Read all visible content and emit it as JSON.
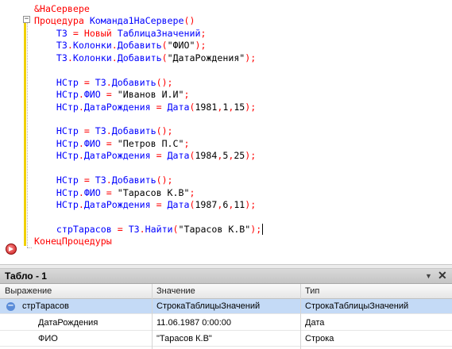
{
  "editor": {
    "lines": [
      [
        [
          "kw",
          "&НаСервере"
        ]
      ],
      [
        [
          "kw",
          "Процедура "
        ],
        [
          "id",
          "Команда1НаСервере"
        ],
        [
          "op",
          "()"
        ]
      ],
      [
        [
          "kw",
          "    "
        ],
        [
          "id",
          "ТЗ"
        ],
        [
          "op",
          " = "
        ],
        [
          "kw",
          "Новый "
        ],
        [
          "id",
          "ТаблицаЗначений"
        ],
        [
          "op",
          ";"
        ]
      ],
      [
        [
          "kw",
          "    "
        ],
        [
          "id",
          "ТЗ"
        ],
        [
          "op",
          "."
        ],
        [
          "id",
          "Колонки"
        ],
        [
          "op",
          "."
        ],
        [
          "id",
          "Добавить"
        ],
        [
          "op",
          "("
        ],
        [
          "str",
          "\"ФИО\""
        ],
        [
          "op",
          ");"
        ]
      ],
      [
        [
          "kw",
          "    "
        ],
        [
          "id",
          "ТЗ"
        ],
        [
          "op",
          "."
        ],
        [
          "id",
          "Колонки"
        ],
        [
          "op",
          "."
        ],
        [
          "id",
          "Добавить"
        ],
        [
          "op",
          "("
        ],
        [
          "str",
          "\"ДатаРождения\""
        ],
        [
          "op",
          ");"
        ]
      ],
      [
        [
          "kw",
          ""
        ]
      ],
      [
        [
          "kw",
          "    "
        ],
        [
          "id",
          "НСтр"
        ],
        [
          "op",
          " = "
        ],
        [
          "id",
          "ТЗ"
        ],
        [
          "op",
          "."
        ],
        [
          "id",
          "Добавить"
        ],
        [
          "op",
          "();"
        ]
      ],
      [
        [
          "kw",
          "    "
        ],
        [
          "id",
          "НСтр"
        ],
        [
          "op",
          "."
        ],
        [
          "id",
          "ФИО"
        ],
        [
          "op",
          " = "
        ],
        [
          "str",
          "\"Иванов И.И\""
        ],
        [
          "op",
          ";"
        ]
      ],
      [
        [
          "kw",
          "    "
        ],
        [
          "id",
          "НСтр"
        ],
        [
          "op",
          "."
        ],
        [
          "id",
          "ДатаРождения"
        ],
        [
          "op",
          " = "
        ],
        [
          "id",
          "Дата"
        ],
        [
          "op",
          "("
        ],
        [
          "num",
          "1981"
        ],
        [
          "op",
          ","
        ],
        [
          "num",
          "1"
        ],
        [
          "op",
          ","
        ],
        [
          "num",
          "15"
        ],
        [
          "op",
          ");"
        ]
      ],
      [
        [
          "kw",
          ""
        ]
      ],
      [
        [
          "kw",
          "    "
        ],
        [
          "id",
          "НСтр"
        ],
        [
          "op",
          " = "
        ],
        [
          "id",
          "ТЗ"
        ],
        [
          "op",
          "."
        ],
        [
          "id",
          "Добавить"
        ],
        [
          "op",
          "();"
        ]
      ],
      [
        [
          "kw",
          "    "
        ],
        [
          "id",
          "НСтр"
        ],
        [
          "op",
          "."
        ],
        [
          "id",
          "ФИО"
        ],
        [
          "op",
          " = "
        ],
        [
          "str",
          "\"Петров П.С\""
        ],
        [
          "op",
          ";"
        ]
      ],
      [
        [
          "kw",
          "    "
        ],
        [
          "id",
          "НСтр"
        ],
        [
          "op",
          "."
        ],
        [
          "id",
          "ДатаРождения"
        ],
        [
          "op",
          " = "
        ],
        [
          "id",
          "Дата"
        ],
        [
          "op",
          "("
        ],
        [
          "num",
          "1984"
        ],
        [
          "op",
          ","
        ],
        [
          "num",
          "5"
        ],
        [
          "op",
          ","
        ],
        [
          "num",
          "25"
        ],
        [
          "op",
          ");"
        ]
      ],
      [
        [
          "kw",
          ""
        ]
      ],
      [
        [
          "kw",
          "    "
        ],
        [
          "id",
          "НСтр"
        ],
        [
          "op",
          " = "
        ],
        [
          "id",
          "ТЗ"
        ],
        [
          "op",
          "."
        ],
        [
          "id",
          "Добавить"
        ],
        [
          "op",
          "();"
        ]
      ],
      [
        [
          "kw",
          "    "
        ],
        [
          "id",
          "НСтр"
        ],
        [
          "op",
          "."
        ],
        [
          "id",
          "ФИО"
        ],
        [
          "op",
          " = "
        ],
        [
          "str",
          "\"Тарасов К.В\""
        ],
        [
          "op",
          ";"
        ]
      ],
      [
        [
          "kw",
          "    "
        ],
        [
          "id",
          "НСтр"
        ],
        [
          "op",
          "."
        ],
        [
          "id",
          "ДатаРождения"
        ],
        [
          "op",
          " = "
        ],
        [
          "id",
          "Дата"
        ],
        [
          "op",
          "("
        ],
        [
          "num",
          "1987"
        ],
        [
          "op",
          ","
        ],
        [
          "num",
          "6"
        ],
        [
          "op",
          ","
        ],
        [
          "num",
          "11"
        ],
        [
          "op",
          ");"
        ]
      ],
      [
        [
          "kw",
          ""
        ]
      ],
      [
        [
          "kw",
          "    "
        ],
        [
          "id",
          "стрТарасов"
        ],
        [
          "op",
          " = "
        ],
        [
          "id",
          "ТЗ"
        ],
        [
          "op",
          "."
        ],
        [
          "id",
          "Найти"
        ],
        [
          "op",
          "("
        ],
        [
          "str",
          "\"Тарасов К.В\""
        ],
        [
          "op",
          ");"
        ]
      ],
      [
        [
          "kw",
          "КонецПроцедуры"
        ]
      ]
    ],
    "cursor_line": 18,
    "fold_symbol": "−"
  },
  "panel": {
    "title": "Табло - 1",
    "pin": "▼",
    "close": "✕",
    "columns": [
      "Выражение",
      "Значение",
      "Тип"
    ],
    "rows": [
      {
        "expr": "стрТарасов",
        "value": "СтрокаТаблицыЗначений",
        "type": "СтрокаТаблицыЗначений",
        "expandable": true,
        "expander": "−"
      },
      {
        "expr": "ДатаРождения",
        "value": "11.06.1987 0:00:00",
        "type": "Дата",
        "expandable": false
      },
      {
        "expr": "ФИО",
        "value": "\"Тарасов К.В\"",
        "type": "Строка",
        "expandable": false
      }
    ]
  },
  "colors": {
    "keyword": "#ff0000",
    "identifier": "#0000ff",
    "selection": "#c4daf6"
  }
}
